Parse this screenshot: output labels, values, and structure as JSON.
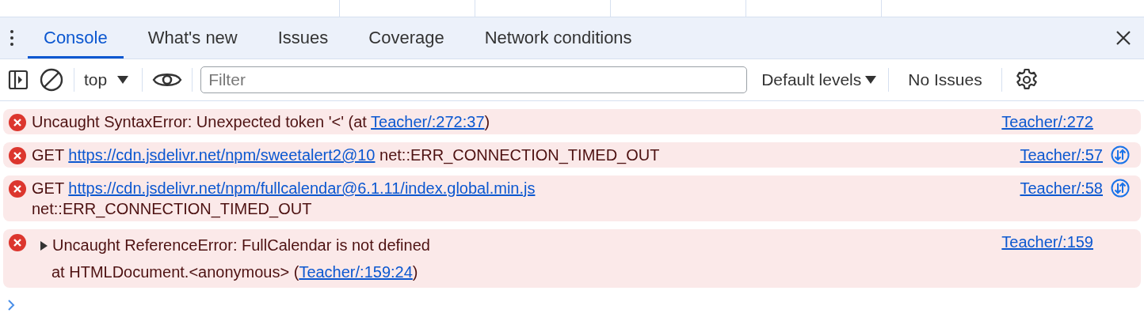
{
  "tabs": [
    {
      "label": "Console",
      "selected": true
    },
    {
      "label": "What's new",
      "selected": false
    },
    {
      "label": "Issues",
      "selected": false
    },
    {
      "label": "Coverage",
      "selected": false
    },
    {
      "label": "Network conditions",
      "selected": false
    }
  ],
  "toolbar": {
    "context": "top",
    "filter": {
      "placeholder": "Filter"
    },
    "levels": "Default levels",
    "issues": "No Issues"
  },
  "messages": [
    {
      "kind": "error",
      "expandable": false,
      "network": false,
      "source": "Teacher/:272",
      "lines": [
        [
          {
            "kind": "text",
            "text": "Uncaught SyntaxError: Unexpected token '<' (at "
          },
          {
            "kind": "link",
            "text": "Teacher/:272:37"
          },
          {
            "kind": "text",
            "text": ")"
          }
        ]
      ]
    },
    {
      "kind": "error",
      "expandable": false,
      "network": true,
      "source": "Teacher/:57",
      "lines": [
        [
          {
            "kind": "text",
            "text": "GET "
          },
          {
            "kind": "link",
            "text": "https://cdn.jsdelivr.net/npm/sweetalert2@10"
          },
          {
            "kind": "text",
            "text": " net::ERR_CONNECTION_TIMED_OUT"
          }
        ]
      ]
    },
    {
      "kind": "error",
      "expandable": false,
      "network": true,
      "source": "Teacher/:58",
      "lines": [
        [
          {
            "kind": "text",
            "text": "GET "
          },
          {
            "kind": "link",
            "text": "https://cdn.jsdelivr.net/npm/fullcalendar@6.1.11/index.global.min.js"
          }
        ],
        [
          {
            "kind": "text",
            "text": "net::ERR_CONNECTION_TIMED_OUT"
          }
        ]
      ]
    },
    {
      "kind": "error",
      "expandable": true,
      "network": false,
      "source": "Teacher/:159",
      "lines": [
        [
          {
            "kind": "text",
            "text": "Uncaught ReferenceError: FullCalendar is not defined"
          }
        ],
        [
          {
            "kind": "text",
            "text": "at HTMLDocument.<anonymous> ("
          },
          {
            "kind": "link",
            "text": "Teacher/:159:24"
          },
          {
            "kind": "text",
            "text": ")"
          }
        ]
      ]
    }
  ]
}
